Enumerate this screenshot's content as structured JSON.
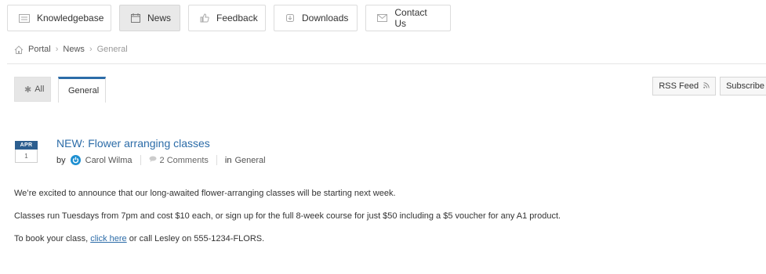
{
  "nav": {
    "items": [
      {
        "label": "Knowledgebase",
        "icon": "list-icon"
      },
      {
        "label": "News",
        "icon": "calendar-icon",
        "active": true
      },
      {
        "label": "Feedback",
        "icon": "thumbs-up-icon"
      },
      {
        "label": "Downloads",
        "icon": "download-icon"
      },
      {
        "label": "Contact Us",
        "icon": "envelope-icon"
      }
    ]
  },
  "breadcrumb": {
    "portal": "Portal",
    "news": "News",
    "current": "General",
    "separator": "›"
  },
  "tabs": {
    "all": "All",
    "general": "General"
  },
  "actions": {
    "rss": "RSS Feed",
    "subscribe": "Subscribe"
  },
  "article": {
    "month": "APR",
    "day": "1",
    "title": "NEW: Flower arranging classes",
    "by": "by",
    "author": "Carol Wilma",
    "comments": "2 Comments",
    "in": "in",
    "category": "General",
    "para1": "We’re excited to announce that our long-awaited flower-arranging classes will be starting next week.",
    "para2": "Classes run Tuesdays from 7pm and cost $10 each, or sign up for the full 8-week course for just $50 including a $5 voucher for any A1 product.",
    "para3_before": "To book your class,",
    "para3_link": "click here",
    "para3_after": "or call Lesley on 555-1234-FLORS."
  },
  "colors": {
    "accent": "#2c6ca8",
    "date_header": "#2c5e8f",
    "avatar": "#1d8fd1"
  }
}
